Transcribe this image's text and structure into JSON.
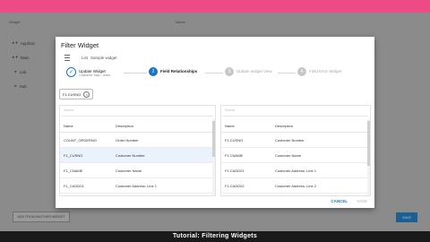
{
  "colors": {
    "appbar": "#ee4a86",
    "accent": "#1a73c8"
  },
  "background": {
    "header_left": "Widget",
    "header_right": "Name",
    "tree": [
      "Applicat",
      "Main",
      "Lab",
      "Sub"
    ],
    "bottom_button": "ADD FROM ANOTHER WIDGET",
    "save_button": "SAVE",
    "caption": "Tutorial: Filtering Widgets"
  },
  "dialog": {
    "title": "Filter Widget",
    "breadcrumb_icon": "list-icon",
    "breadcrumb_item1": "List",
    "breadcrumb_item2": "Sample widget",
    "steps": [
      {
        "title": "Update Widget",
        "subtitle": "Customer Map - video",
        "state": "done"
      },
      {
        "number": "2",
        "title": "Field Relationships",
        "state": "active"
      },
      {
        "number": "3",
        "title": "Update widget View",
        "state": "pending"
      },
      {
        "number": "4",
        "title": "Field Error Widget",
        "state": "pending"
      }
    ],
    "chip_label": "F1.CUSNO",
    "left_panel": {
      "search_placeholder": "Search",
      "col_name": "Name",
      "col_desc": "Description",
      "rows": [
        {
          "name": "COUNT_ORDERNO",
          "desc": "Order Number"
        },
        {
          "name": "F1_CUSNO",
          "desc": "Customer Number"
        },
        {
          "name": "F1_CNAME",
          "desc": "Customer Name"
        },
        {
          "name": "F1_CADD01",
          "desc": "Customer Address: Line 1"
        }
      ]
    },
    "right_panel": {
      "search_placeholder": "Search",
      "col_name": "Name",
      "col_desc": "Description",
      "rows": [
        {
          "name": "F1.CUSNO",
          "desc": "Customer Number"
        },
        {
          "name": "F1.CNAME",
          "desc": "Customer Name"
        },
        {
          "name": "F1.CADD01",
          "desc": "Customer Address: Line 1"
        },
        {
          "name": "F1.CADD02",
          "desc": "Customer Address: Line 2"
        }
      ]
    },
    "cancel_label": "CANCEL",
    "save_label": "SAVE"
  }
}
